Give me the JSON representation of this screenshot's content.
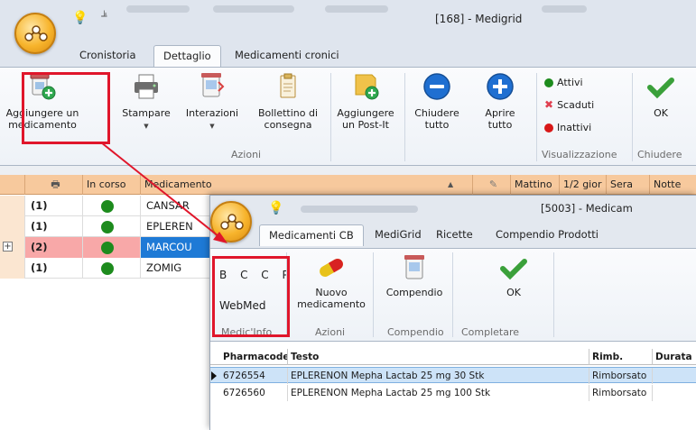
{
  "main_window": {
    "title": "[168] - Medigrid",
    "tabs": [
      "Cronistoria",
      "Dettaglio",
      "Medicamenti cronici"
    ],
    "active_tab": "Dettaglio",
    "ribbon": {
      "add_medication": {
        "line1": "Aggiungere un",
        "line2": "medicamento",
        "icon": "pill-bottle-add-icon"
      },
      "print": {
        "label": "Stampare",
        "icon": "printer-icon"
      },
      "interactions": {
        "label": "Interazioni",
        "icon": "interactions-icon"
      },
      "delivery_note": {
        "line1": "Bollettino di",
        "line2": "consegna",
        "icon": "clipboard-icon"
      },
      "add_postit": {
        "line1": "Aggiungere",
        "line2": "un Post-It",
        "icon": "postit-add-icon"
      },
      "close_all": {
        "line1": "Chiudere",
        "line2": "tutto",
        "icon": "minus-circle-icon"
      },
      "open_all": {
        "line1": "Aprire",
        "line2": "tutto",
        "icon": "plus-circle-icon"
      },
      "visual_items": [
        {
          "label": "Attivi",
          "color": "#1d8b1d"
        },
        {
          "label": "Scaduti",
          "color": "#e04050"
        },
        {
          "label": "Inattivi",
          "color": "#d81818"
        }
      ],
      "ok": {
        "label": "OK",
        "icon": "checkmark-icon"
      },
      "groups": {
        "actions": "Azioni",
        "visualization": "Visualizzazione",
        "close": "Chiudere"
      }
    },
    "grid": {
      "headers": [
        "In corso",
        "Medicamento",
        "Mattino",
        "1/2 gior",
        "Sera",
        "Notte"
      ],
      "rows": [
        {
          "count": "(1)",
          "name": "CANSAR",
          "highlighted": false
        },
        {
          "count": "(1)",
          "name": "EPLEREN",
          "highlighted": false
        },
        {
          "count": "(2)",
          "name": "MARCOU",
          "highlighted": true
        },
        {
          "count": "(1)",
          "name": "ZOMIG",
          "highlighted": false
        }
      ]
    }
  },
  "child_window": {
    "title": "[5003] - Medicam",
    "tabs": [
      "Medicamenti CB",
      "MediGrid",
      "Ricette",
      "Compendio Prodotti"
    ],
    "active_tab": "Medicamenti CB",
    "ribbon": {
      "letters": [
        "B",
        "C",
        "C",
        "P"
      ],
      "webmed": "WebMed",
      "new_med": {
        "line1": "Nuovo",
        "line2": "medicamento",
        "icon": "capsule-icon"
      },
      "compendio": {
        "label": "Compendio",
        "icon": "compendium-icon"
      },
      "ok": {
        "label": "OK",
        "icon": "checkmark-icon"
      },
      "groups": {
        "medicinfo": "Medic'Info",
        "actions": "Azioni",
        "compendio": "Compendio",
        "complete": "Completare"
      }
    },
    "grid": {
      "headers": [
        "Pharmacode",
        "Testo",
        "Rimb.",
        "Durata"
      ],
      "rows": [
        {
          "pharmacode": "6726554",
          "text": "EPLERENON Mepha Lactab 25 mg 30 Stk",
          "rimb": "Rimborsato",
          "selected": true
        },
        {
          "pharmacode": "6726560",
          "text": "EPLERENON Mepha Lactab 25 mg 100 Stk",
          "rimb": "Rimborsato",
          "selected": false
        }
      ]
    }
  }
}
